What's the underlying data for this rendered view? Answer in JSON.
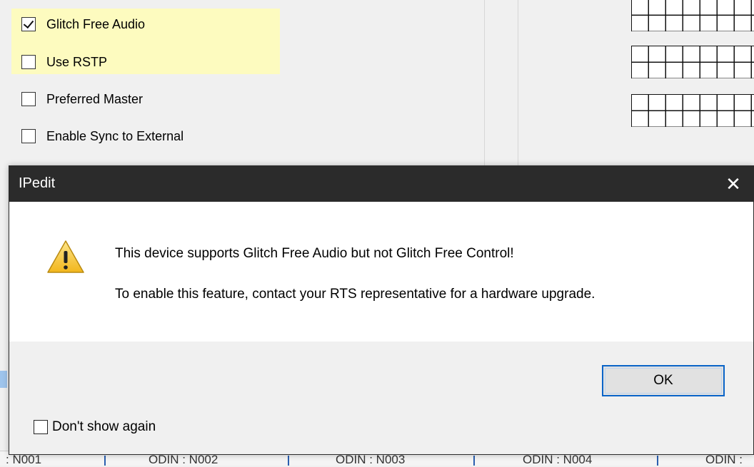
{
  "background": {
    "options": [
      {
        "label": "Glitch Free Audio",
        "checked": true
      },
      {
        "label": "Use RSTP",
        "checked": false
      },
      {
        "label": "Preferred Master",
        "checked": false
      },
      {
        "label": "Enable Sync to External",
        "checked": false
      }
    ],
    "bottom_labels": [
      ": N001",
      "ODIN : N002",
      "ODIN : N003",
      "ODIN : N004",
      "ODIN :"
    ]
  },
  "dialog": {
    "title": "IPedit",
    "close_symbol": "✕",
    "icon": "warning-icon",
    "message_line1": "This device supports Glitch Free Audio but not Glitch Free Control!",
    "message_line2": "To enable this feature, contact your RTS representative for a hardware upgrade.",
    "ok_label": "OK",
    "dont_show_label": "Don't show again",
    "dont_show_checked": false
  },
  "colors": {
    "highlight": "#fdfbbf",
    "titlebar": "#2b2b2b",
    "ok_border": "#0a64c8",
    "warning_fill": "#f6c631"
  }
}
